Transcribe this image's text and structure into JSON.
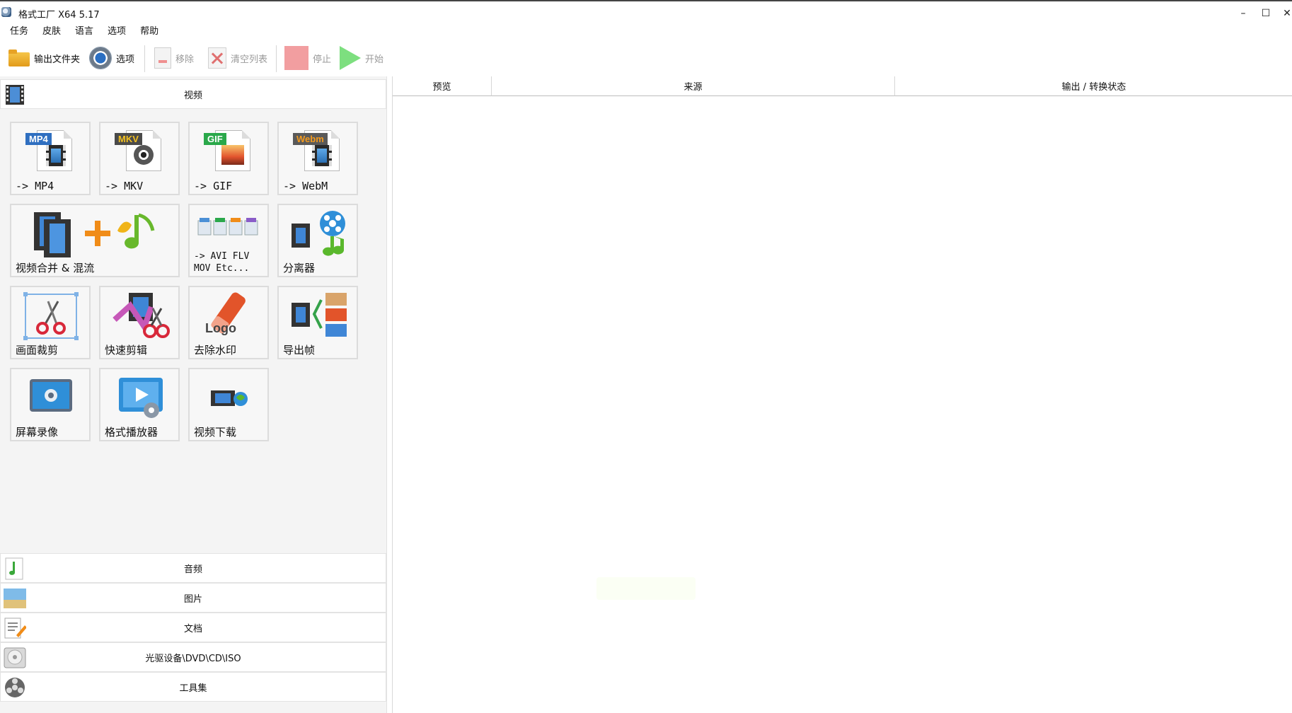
{
  "window": {
    "title": "格式工厂 X64 5.17",
    "minimize": "–",
    "maximize": "☐",
    "close": "✕"
  },
  "menu": [
    "任务",
    "皮肤",
    "语言",
    "选项",
    "帮助"
  ],
  "toolbar": {
    "output_folder": "输出文件夹",
    "options": "选项",
    "remove": "移除",
    "clear_list": "清空列表",
    "stop": "停止",
    "start": "开始"
  },
  "categories": {
    "video": "视频",
    "audio": "音频",
    "image": "图片",
    "document": "文档",
    "rom": "光驱设备\\DVD\\CD\\ISO",
    "tools": "工具集"
  },
  "tiles": [
    {
      "label": "-> MP4",
      "badge": "MP4",
      "badge_color": "#2f6fc0",
      "icon": "mp4-file-icon"
    },
    {
      "label": "-> MKV",
      "badge": "MKV",
      "badge_color": "#4a4a4a",
      "icon": "mkv-file-icon"
    },
    {
      "label": "-> GIF",
      "badge": "GIF",
      "badge_color": "#2aa84a",
      "icon": "gif-file-icon"
    },
    {
      "label": "-> WebM",
      "badge": "Webm",
      "badge_color": "#5a5a5a",
      "icon": "webm-file-icon"
    },
    {
      "label": "视频合并 & 混流",
      "icon": "video-merge-icon"
    },
    {
      "label": "-> AVI FLV\nMOV Etc...",
      "icon": "other-formats-icon"
    },
    {
      "label": "分离器",
      "icon": "splitter-icon"
    },
    {
      "label": "画面裁剪",
      "icon": "crop-icon"
    },
    {
      "label": "快速剪辑",
      "icon": "quick-clip-icon"
    },
    {
      "label": "去除水印",
      "icon": "remove-watermark-icon"
    },
    {
      "label": "导出帧",
      "icon": "export-frames-icon"
    },
    {
      "label": "屏幕录像",
      "icon": "screen-record-icon"
    },
    {
      "label": "格式播放器",
      "icon": "player-icon"
    },
    {
      "label": "视频下载",
      "icon": "video-download-icon"
    }
  ],
  "task_list": {
    "columns": [
      "预览",
      "来源",
      "输出 / 转换状态"
    ]
  }
}
